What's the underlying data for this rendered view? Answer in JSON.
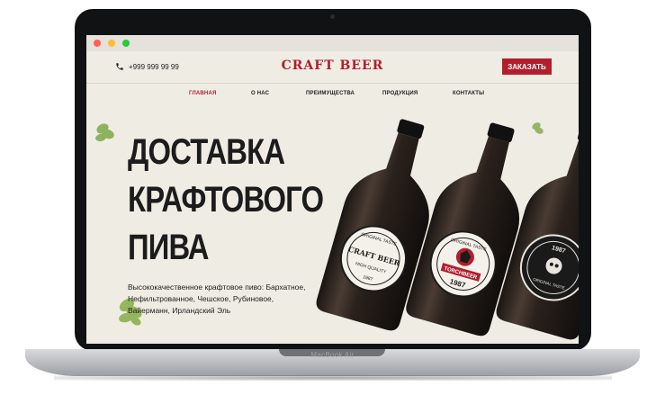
{
  "device": {
    "model_label": "MacBook Air"
  },
  "header": {
    "phone": "+999 999 99 99",
    "logo": "CRAFT BEER",
    "order_button": "ЗАКАЗАТЬ"
  },
  "nav": {
    "items": [
      {
        "label": "ГЛАВНАЯ",
        "active": true
      },
      {
        "label": "О НАС",
        "active": false
      },
      {
        "label": "ПРЕИМУЩЕСТВА",
        "active": false
      },
      {
        "label": "ПРОДУКЦИЯ",
        "active": false
      },
      {
        "label": "КОНТАКТЫ",
        "active": false
      }
    ]
  },
  "hero": {
    "title_lines": [
      "ДОСТАВКА",
      "КРАФТОВОГО",
      "ПИВА"
    ],
    "description": "Высококачественное крафтовое пиво: Бархатное, Нефильтрованное, Чешское, Рубиновое, Вайерманн, Ирландский Эль"
  },
  "bottles": [
    {
      "label_top": "ORIGINAL TASTE",
      "label_main": "CRAFT BEER",
      "label_sub": "HIGH QUALITY",
      "label_year": "1987"
    },
    {
      "label_top": "ORIGINAL TASTE",
      "label_main": "TORCHBEER",
      "label_year": "1987"
    },
    {
      "label_top": "1987",
      "label_main": "ORIGINAL TASTE"
    }
  ],
  "colors": {
    "accent": "#b21e2d",
    "page_background": "#efece3",
    "text": "#1c1c1c"
  }
}
